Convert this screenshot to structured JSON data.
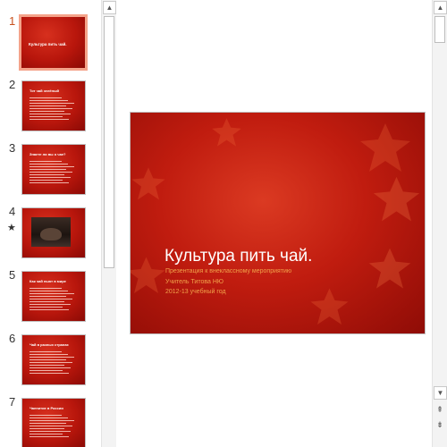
{
  "thumbnails": [
    {
      "number": "1",
      "selected": true,
      "star": "",
      "title": "Культура пить чай.",
      "kind": "title"
    },
    {
      "number": "2",
      "selected": false,
      "star": "",
      "title": "Тот чай зелёный",
      "kind": "text"
    },
    {
      "number": "3",
      "selected": false,
      "star": "",
      "title": "Знаете ли вы о чае?",
      "kind": "text"
    },
    {
      "number": "4",
      "selected": false,
      "star": "★",
      "title": "",
      "kind": "photo"
    },
    {
      "number": "5",
      "selected": false,
      "star": "",
      "title": "Как чай пьют в мире",
      "kind": "text"
    },
    {
      "number": "6",
      "selected": false,
      "star": "",
      "title": "Чай в разных странах",
      "kind": "text"
    },
    {
      "number": "7",
      "selected": false,
      "star": "",
      "title": "Чаепитие в России",
      "kind": "text"
    }
  ],
  "slide": {
    "title": "Культура пить чай.",
    "subtitle_lines": [
      "Презентация к внеклассному мероприятию",
      "Учитель Титова НЮ",
      "2012-13 учебный год"
    ]
  },
  "scrollbars": {
    "up_glyph": "▲",
    "down_glyph": "▼",
    "prev_slide_glyph": "⇞",
    "next_slide_glyph": "⇟"
  },
  "colors": {
    "active_number": "#c8511e",
    "selected_border": "#f4a38a",
    "slide_red": "#c01c0f",
    "subtitle_orange": "#f0a24a"
  }
}
